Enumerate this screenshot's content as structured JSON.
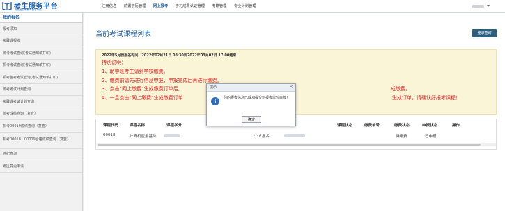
{
  "header": {
    "logo_title": "考生服务平台",
    "logo_subtitle": "湖北省高等教育自学考试",
    "nav": [
      "注册信息",
      "前置学历管理",
      "网上报考",
      "学习成果认证管理",
      "考籍管理",
      "专业计划管理"
    ],
    "active_nav_index": 2
  },
  "sidebar": {
    "title": "我的报名",
    "items": [
      "报考须知",
      "实践课报考",
      "统考考试查询(考试通知单打印)",
      "机考考试查询(考试通知单打印)",
      "机考备考考试查询(考试通知单打印)",
      "统考考试计划查询",
      "实践课考试计划查询",
      "统考成绩查询（复查）",
      "机考00019成绩查询（复查）",
      "机考00018、00019合格成绩查询（复查）",
      "违纪查询",
      "考区变更申请"
    ]
  },
  "main": {
    "title": "当前考试课程列表",
    "login_button": "登录查询",
    "notice": {
      "time": "2022年5月份报名时间：2022年02月21日 08:30到2022年03月02日 17:00结束",
      "heading": "特别说明：",
      "lines": [
        "1、助学班考生请到学校缴费。",
        "2、缴费前请先进行信息申报，申报完成后再进行缴费。",
        "3、点击“网上缴费”生成缴费订单后,",
        "4、一旦点击”网上缴费“生成缴费订单"
      ],
      "line3_tail": "成缴费。",
      "line4_tail": "生成订单，请确认好报考课程！"
    },
    "table": {
      "headers": [
        "课程代码",
        "课程名称",
        "课程学分",
        "课程状态",
        "缴费单号",
        "缴费状态",
        "申报状态",
        "操作"
      ],
      "rows": [
        {
          "code": "00018",
          "name": "计算机应用基础",
          "type": "个人报名",
          "pay_status": "待缴费",
          "declare_status": "已申报"
        }
      ]
    }
  },
  "dialog": {
    "title": "提示",
    "close": "×",
    "icon_glyph": "i",
    "message": "你的报考信息已成功提交到报考单位审核！",
    "ok": "确定"
  }
}
